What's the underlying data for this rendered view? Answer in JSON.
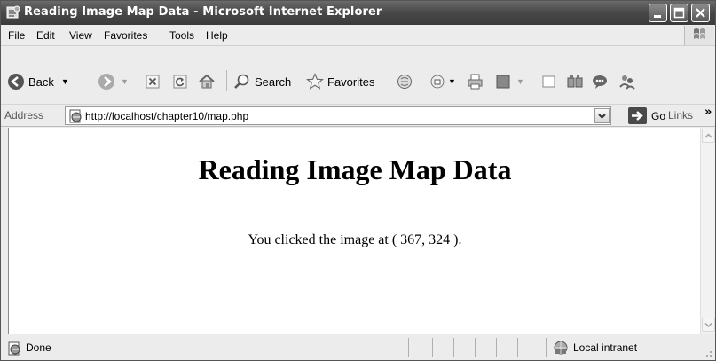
{
  "window": {
    "title": "Reading Image Map Data - Microsoft Internet Explorer"
  },
  "menu": {
    "items": [
      "File",
      "Edit",
      "View",
      "Favorites",
      "Tools",
      "Help"
    ]
  },
  "toolbar": {
    "back_label": "Back",
    "search_label": "Search",
    "favorites_label": "Favorites"
  },
  "address": {
    "label": "Address",
    "url": "http://localhost/chapter10/map.php",
    "go_label": "Go",
    "links_label": "Links"
  },
  "page": {
    "heading": "Reading Image Map Data",
    "message": "You clicked the image at ( 367, 324 )."
  },
  "status": {
    "text": "Done",
    "zone": "Local intranet"
  }
}
